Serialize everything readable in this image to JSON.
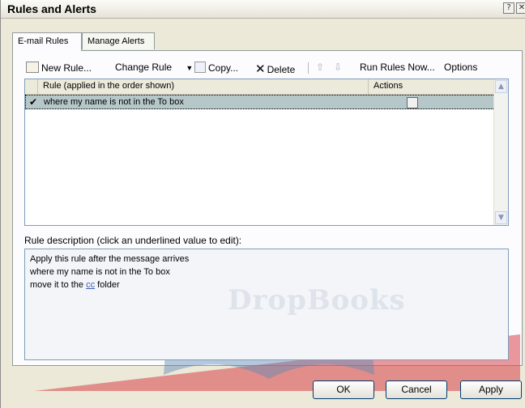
{
  "window": {
    "title": "Rules and Alerts"
  },
  "tabs": [
    {
      "label": "E-mail Rules",
      "active": true
    },
    {
      "label": "Manage Alerts",
      "active": false
    }
  ],
  "toolbar": {
    "new_rule": "New Rule...",
    "change_rule": "Change Rule",
    "copy": "Copy...",
    "delete": "Delete",
    "run_rules_now": "Run Rules Now...",
    "options": "Options"
  },
  "rules_list": {
    "columns": [
      "Rule (applied in the order shown)",
      "Actions"
    ],
    "rows": [
      {
        "checked": true,
        "rule": "where my name is not in the To box"
      }
    ]
  },
  "description": {
    "label": "Rule description (click an underlined value to edit):",
    "line1": "Apply this rule after the message arrives",
    "line2": "where my name is not in the To box",
    "line3_prefix": "move it to the ",
    "line3_link": "cc",
    "line3_suffix": " folder"
  },
  "watermark": "DropBooks",
  "buttons": {
    "ok": "OK",
    "cancel": "Cancel",
    "apply": "Apply"
  },
  "colors": {
    "selected_row": "#b6c7c9",
    "watermark_band": "#d8444a",
    "link": "#3a5db5"
  }
}
